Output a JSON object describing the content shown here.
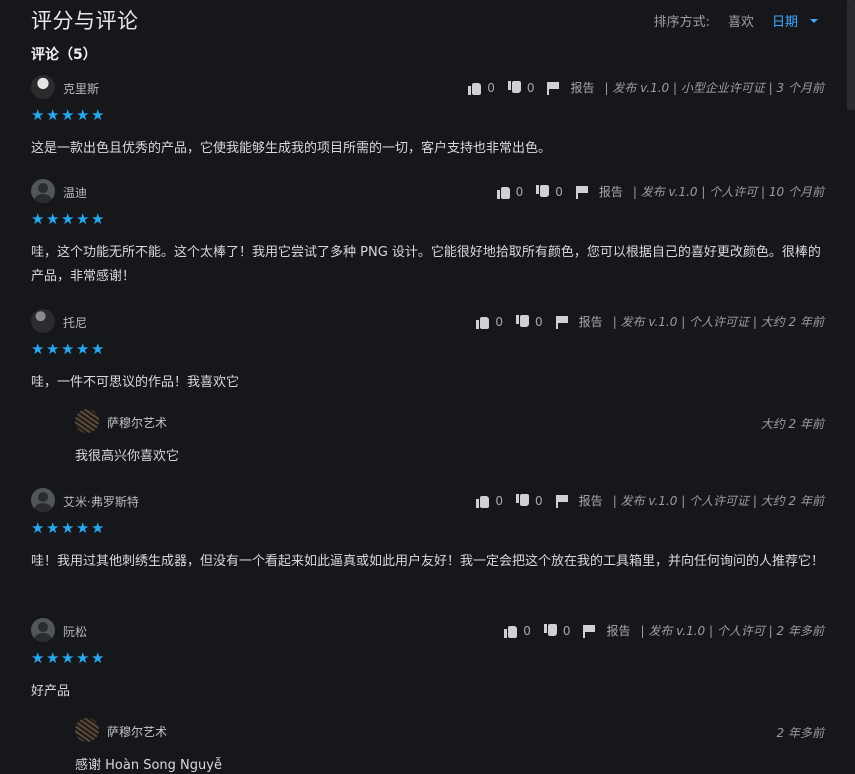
{
  "header": {
    "title": "评分与评论",
    "sort_label": "排序方式:",
    "sort_options": [
      "喜欢",
      "日期"
    ],
    "active_sort": "日期"
  },
  "reviews_title": "评论（5）",
  "reviews": [
    {
      "author": "克里斯",
      "likes": "0",
      "dislikes": "0",
      "report": "报告",
      "meta": "| 发布 v.1.0 | 小型企业许可证 | 3 个月前",
      "stars": 5,
      "text": "这是一款出色且优秀的产品，它使我能够生成我的项目所需的一切，客户支持也非常出色。",
      "avatar": "avatar-image"
    },
    {
      "author": "温迪",
      "likes": "0",
      "dislikes": "0",
      "report": "报告",
      "meta": "| 发布 v.1.0 | 个人许可 | 10 个月前",
      "stars": 5,
      "text": "哇，这个功能无所不能。这个太棒了！我用它尝试了多种 PNG 设计。它能很好地拾取所有颜色，您可以根据自己的喜好更改颜色。很棒的产品，非常感谢！",
      "avatar": "default-avatar"
    },
    {
      "author": "托尼",
      "likes": "0",
      "dislikes": "0",
      "report": "报告",
      "meta": "| 发布 v.1.0 | 个人许可证 | 大约 2 年前",
      "stars": 5,
      "text": "哇，一件不可思议的作品！我喜欢它",
      "avatar": "avatar-image",
      "reply": {
        "author": "萨穆尔艺术",
        "time": "大约 2 年前",
        "text": "我很高兴你喜欢它"
      }
    },
    {
      "author": "艾米·弗罗斯特",
      "likes": "0",
      "dislikes": "0",
      "report": "报告",
      "meta": "| 发布 v.1.0 | 个人许可证 | 大约 2 年前",
      "stars": 5,
      "text": "哇！我用过其他刺绣生成器，但没有一个看起来如此逼真或如此用户友好！我一定会把这个放在我的工具箱里，并向任何询问的人推荐它！",
      "avatar": "default-avatar"
    },
    {
      "author": "阮松",
      "likes": "0",
      "dislikes": "0",
      "report": "报告",
      "meta": "| 发布 v.1.0 | 个人许可 | 2 年多前",
      "stars": 5,
      "text": "好产品",
      "avatar": "default-avatar",
      "reply": {
        "author": "萨穆尔艺术",
        "time": "2 年多前",
        "text": "感谢 Hoàn Song Nguyễ"
      }
    }
  ]
}
